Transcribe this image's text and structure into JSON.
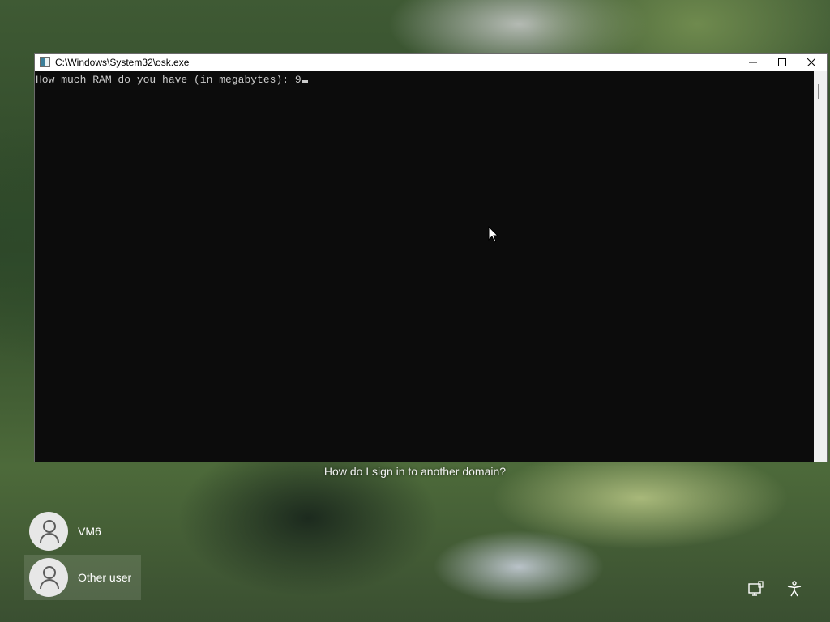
{
  "window": {
    "title": "C:\\Windows\\System32\\osk.exe",
    "minimize_glyph": "—",
    "maximize_glyph": "☐",
    "close_glyph": "✕"
  },
  "console": {
    "prompt": "How much RAM do you have (in megabytes): ",
    "input_value": "9"
  },
  "lockscreen": {
    "help_link": "How do I sign in to another domain?",
    "users": [
      {
        "name": "VM6"
      },
      {
        "name": "Other user"
      }
    ],
    "icons": [
      "network-icon",
      "accessibility-icon"
    ]
  },
  "colors": {
    "console_bg": "#0c0c0c",
    "console_text": "#cccccc",
    "titlebar_bg": "#ffffff"
  }
}
